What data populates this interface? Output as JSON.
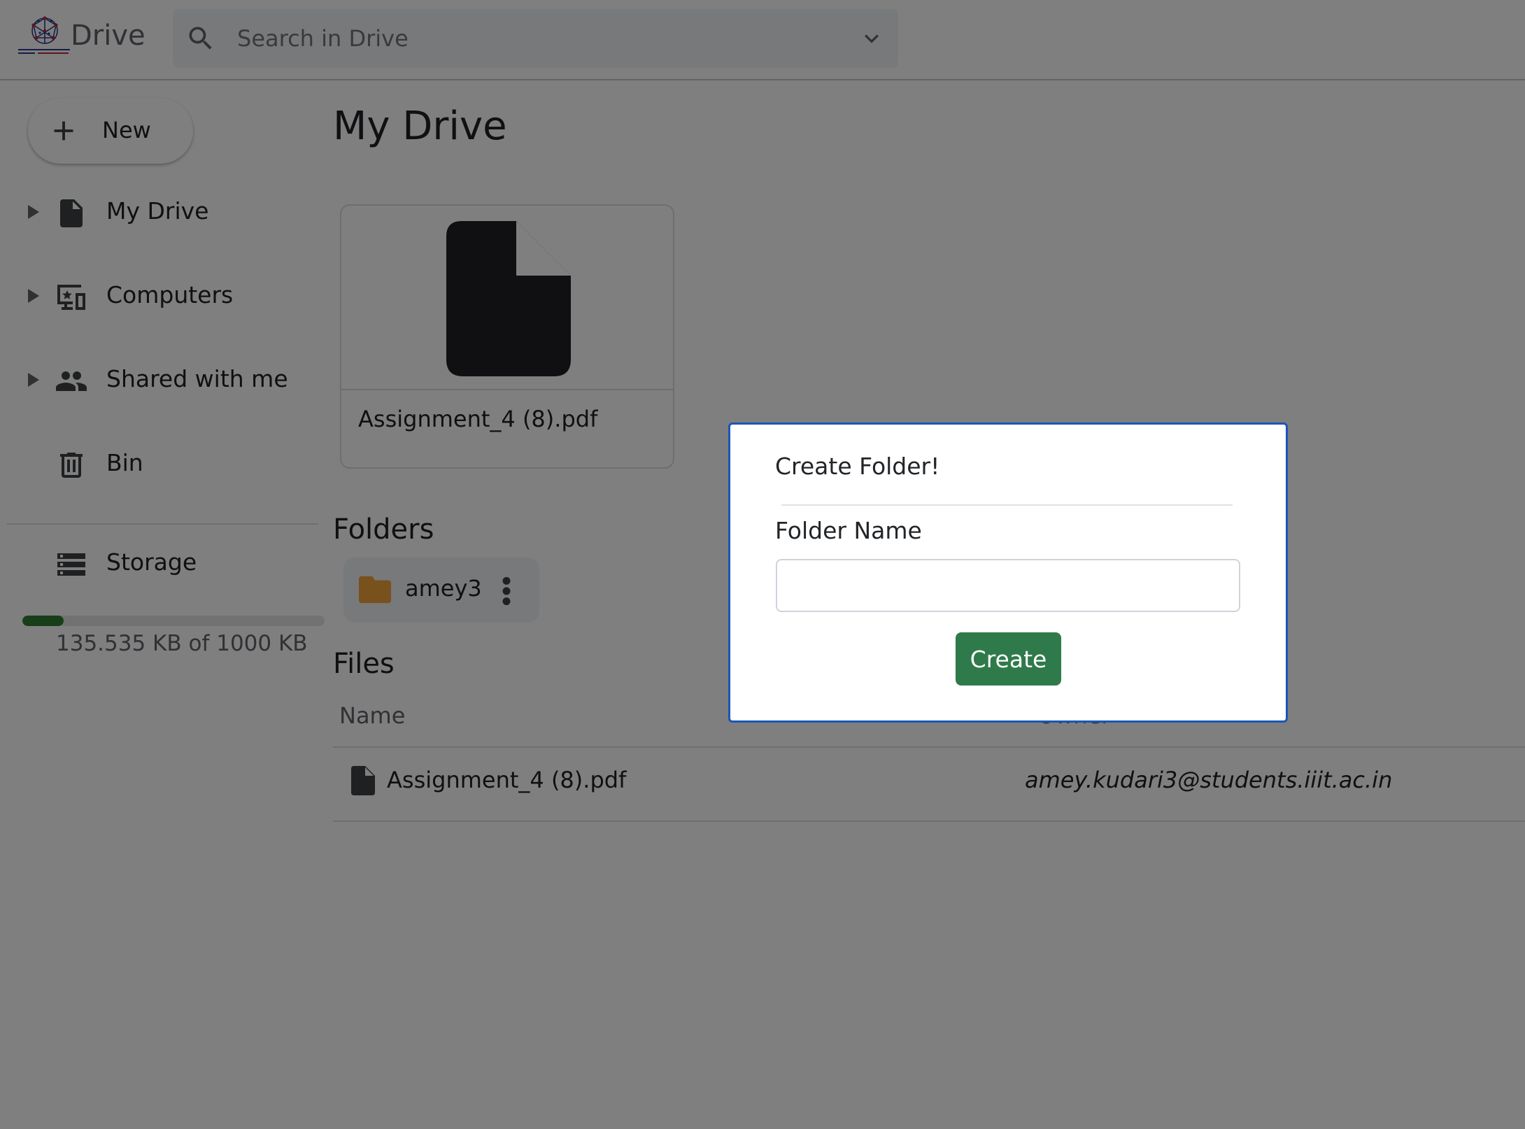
{
  "header": {
    "app_title": "Drive",
    "search_placeholder": "Search in Drive",
    "search_value": ""
  },
  "sidebar": {
    "new_label": "New",
    "items": [
      {
        "label": "My Drive",
        "icon": "file-icon"
      },
      {
        "label": "Computers",
        "icon": "computer-icon"
      },
      {
        "label": "Shared with me",
        "icon": "people-icon"
      },
      {
        "label": "Bin",
        "icon": "trash-icon"
      }
    ],
    "storage": {
      "label": "Storage",
      "icon": "storage-icon",
      "usage_text": "135.535 KB of 1000 KB",
      "used_fraction": 0.1355
    }
  },
  "main": {
    "title": "My Drive",
    "suggested_file": {
      "name": "Assignment_4 (8).pdf"
    },
    "folders_title": "Folders",
    "folders": [
      {
        "name": "amey3"
      }
    ],
    "files_title": "Files",
    "files_columns": {
      "name": "Name",
      "owner": "Owner"
    },
    "files": [
      {
        "name": "Assignment_4 (8).pdf",
        "owner": "amey.kudari3@students.iiit.ac.in"
      }
    ]
  },
  "modal": {
    "title": "Create Folder!",
    "field_label": "Folder Name",
    "field_value": "",
    "create_label": "Create"
  },
  "colors": {
    "accent_green": "#2f7a4a",
    "modal_border": "#1a56b8",
    "folder": "#f2a33a",
    "storage_fill": "#2e7d32"
  }
}
